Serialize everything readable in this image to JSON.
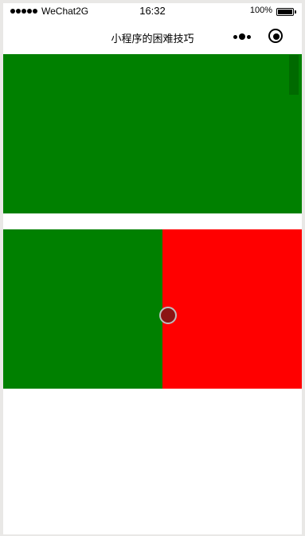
{
  "status_bar": {
    "carrier": "WeChat2G",
    "time": "16:32",
    "battery_percent": "100%"
  },
  "nav": {
    "title": "小程序的困难技巧",
    "menu_icon": "more-dots-icon",
    "close_icon": "target-close-icon"
  },
  "colors": {
    "green": "#008000",
    "red": "#ff0000",
    "handle": "#8c1414"
  }
}
